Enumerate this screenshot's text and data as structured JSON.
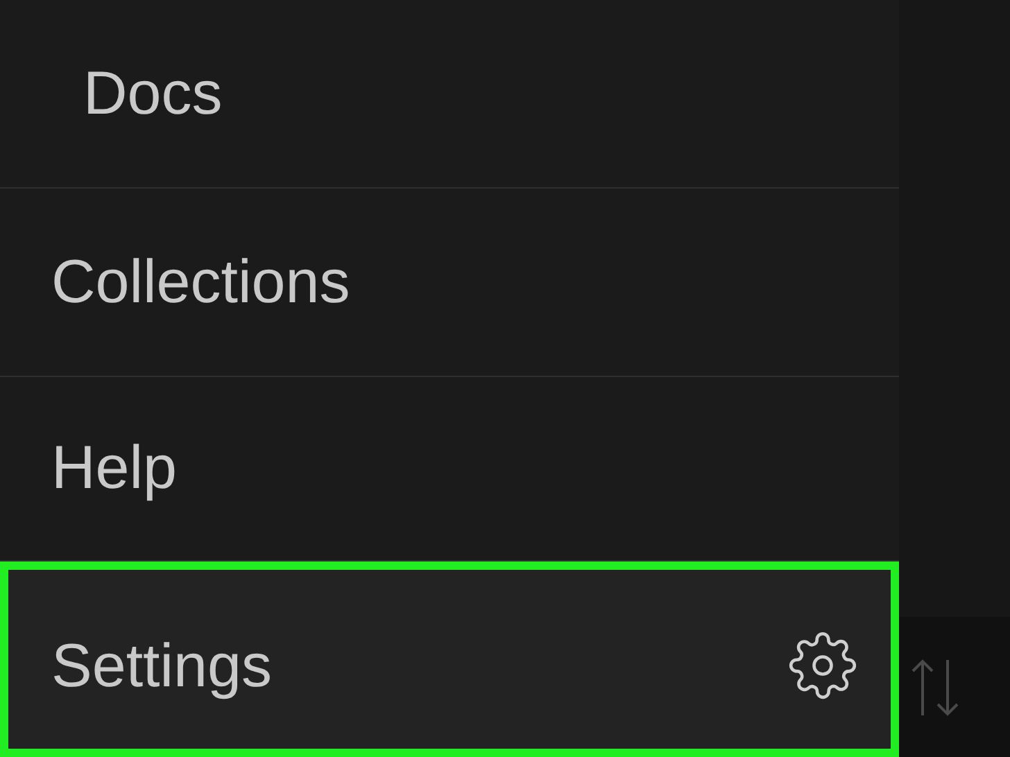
{
  "menu": {
    "items": [
      {
        "label": "Docs",
        "kind": "indented",
        "highlighted": false,
        "has_icon": false
      },
      {
        "label": "Collections",
        "kind": "plain",
        "highlighted": false,
        "has_icon": false
      },
      {
        "label": "Help",
        "kind": "plain",
        "highlighted": false,
        "has_icon": false
      },
      {
        "label": "Settings",
        "kind": "plain",
        "highlighted": true,
        "has_icon": true
      }
    ]
  },
  "side_panel": {
    "has_sort_control": true
  }
}
